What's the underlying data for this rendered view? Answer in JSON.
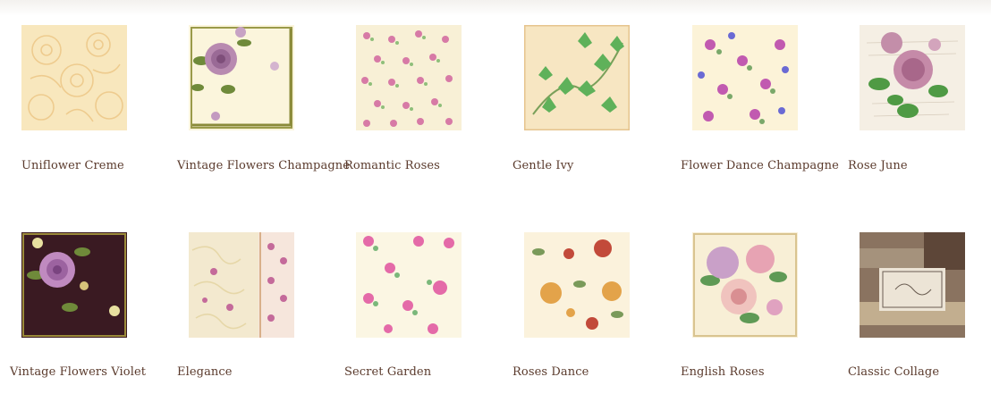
{
  "products": [
    {
      "name": "Uniflower Creme",
      "thumbnail": "cream-floral-napkin"
    },
    {
      "name": "Vintage Flowers Champagne",
      "thumbnail": "vintage-rose-champagne-napkin"
    },
    {
      "name": "Romantic Roses",
      "thumbnail": "small-roses-pattern-napkin"
    },
    {
      "name": "Gentle Ivy",
      "thumbnail": "ivy-leaves-napkin"
    },
    {
      "name": "Flower Dance Champagne",
      "thumbnail": "scattered-flowers-napkin"
    },
    {
      "name": "Rose June",
      "thumbnail": "pink-rose-bouquet-napkin"
    },
    {
      "name": "Vintage Flowers Violet",
      "thumbnail": "violet-rose-napkin"
    },
    {
      "name": "Elegance",
      "thumbnail": "elegance-border-napkin"
    },
    {
      "name": "Secret Garden",
      "thumbnail": "pink-blossom-napkin"
    },
    {
      "name": "Roses Dance",
      "thumbnail": "orange-red-roses-napkin"
    },
    {
      "name": "English Roses",
      "thumbnail": "english-roses-bouquet-napkin"
    },
    {
      "name": "Classic Collage",
      "thumbnail": "classic-collage-napkin"
    }
  ],
  "colors": {
    "label_text": "#5a3a2c",
    "cream": "#f6e3b4",
    "violet_bg": "#3a1a22",
    "ivy_green": "#5fb15a",
    "rose_pink": "#c98aa6",
    "collage_brown": "#8a7360"
  }
}
